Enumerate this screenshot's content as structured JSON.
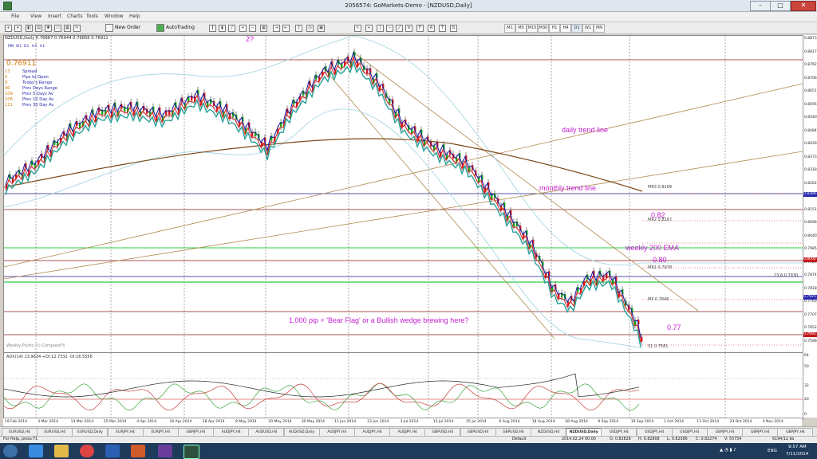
{
  "window": {
    "title": "2056574: GoMarkets-Demo - [NZDUSD,Daily]"
  },
  "menu": [
    "File",
    "View",
    "Insert",
    "Charts",
    "Tools",
    "Window",
    "Help"
  ],
  "toolbar": {
    "new_order": "New Order",
    "autotrading": "AutoTrading",
    "periods": [
      "M1",
      "M5",
      "M15",
      "M30",
      "H1",
      "H4",
      "D1",
      "W1",
      "MN"
    ]
  },
  "chart": {
    "header": "NZDUSD,Daily  0.76887 0.76944 0.76856 0.76911",
    "mini_timeframes": [
      "MN",
      "W1",
      "D1",
      "H4",
      "H1"
    ],
    "bid": "0.76911",
    "info_rows": [
      {
        "num": "13",
        "label": "Spread"
      },
      {
        "num": "2",
        "label": "Pips to Open"
      },
      {
        "num": "9",
        "label": "Today's Range"
      },
      {
        "num": "90",
        "label": "Prev Days Range"
      },
      {
        "num": "109",
        "label": "Prev 5 Days Av"
      },
      {
        "num": "106",
        "label": "Prev 10 Day Av"
      },
      {
        "num": "111",
        "label": "Prev 30 Day Av"
      }
    ],
    "annotations": {
      "question": "2?",
      "daily_trend": "daily trend line",
      "monthly_trend": "monthly trend line",
      "level_082": "0.82",
      "weekly_ema": "weekly 200 EMA",
      "level_080": "0.80",
      "main_note": "1,000 pip + 'Bear Flag' or a Bullish wedge brewing here?",
      "level_077": "0.77"
    },
    "levels": [
      {
        "text": "MR3 0.8289"
      },
      {
        "text": "MR2 0.8167"
      },
      {
        "text": "MR1 0.7978"
      },
      {
        "text": "MP 0.7846"
      },
      {
        "text": "S1 0.7581"
      },
      {
        "text": "23.6 0.7930"
      }
    ],
    "weekly_pivots_label": "Weekly Pivots (c) CompassFX",
    "indicator_header": "ADX(14) 13.9634 +DI:12.7332 -DI:16.5556",
    "price_labels": [
      "0.88730",
      "0.88175",
      "0.87620",
      "0.87065",
      "0.86510",
      "0.85955",
      "0.85400",
      "0.84845",
      "0.84290",
      "0.83735",
      "0.83180",
      "0.82625",
      "0.82070",
      "0.81515",
      "0.80960",
      "0.80405",
      "0.79850",
      "0.79295",
      "0.78740",
      "0.78185",
      "0.77630",
      "0.77075",
      "0.76520",
      "0.75965"
    ],
    "adx_scale": [
      "64",
      "50",
      "32",
      "20",
      "0"
    ],
    "dates": [
      "19 Feb 2014",
      "3 Mar 2014",
      "13 Mar 2014",
      "25 Mar 2014",
      "4 Apr 2014",
      "16 Apr 2014",
      "28 Apr 2014",
      "8 May 2014",
      "20 May 2014",
      "30 May 2014",
      "11 Jun 2014",
      "23 Jun 2014",
      "3 Jul 2014",
      "15 Jul 2014",
      "25 Jul 2014",
      "6 Aug 2014",
      "18 Aug 2014",
      "28 Aug 2014",
      "9 Sep 2014",
      "19 Sep 2014",
      "1 Oct 2014",
      "13 Oct 2014",
      "23 Oct 2014",
      "4 Nov 2014"
    ]
  },
  "tabs": [
    "EURUSD,H4",
    "EURUSD,H4",
    "EURUSD,Daily",
    "EURJPY,H4",
    "EURJPY,H4",
    "GBPJPY,H4",
    "AUDJPY,H4",
    "AUDUSD,H4",
    "AUDUSD,Daily",
    "AUDJPY,H4",
    "AUDJPY,H4",
    "AUDJPY,H4",
    "GBPUSD,H4",
    "GBPUSD,H4",
    "GBPUSD,H4",
    "NZDUSD,H4",
    "NZDUSD,Daily",
    "USDJPY,H4",
    "USDJPY,H4",
    "USDJPY,H4",
    "GBPJPY,H4",
    "GBPJPY,H4",
    "GBPJPY,H4"
  ],
  "status": {
    "help": "For Help, press F1",
    "profile": "Default",
    "datetime": "2014.02.24 00:00",
    "o": "O: 0.82828",
    "h": "H: 0.82808",
    "l": "L: 0.82586",
    "c": "C: 0.82274",
    "v": "V: 55734",
    "traffic": "6194/12 kb"
  },
  "taskbar": {
    "lang": "ENG",
    "time": "9:57 AM",
    "date": "7/11/2014"
  },
  "colors": {
    "annotation": "#c31fcf",
    "sma": "#1a1a9e",
    "ema_red": "#d62020",
    "ema_teal": "#2aa198",
    "ema200": "#7a4a1a"
  }
}
